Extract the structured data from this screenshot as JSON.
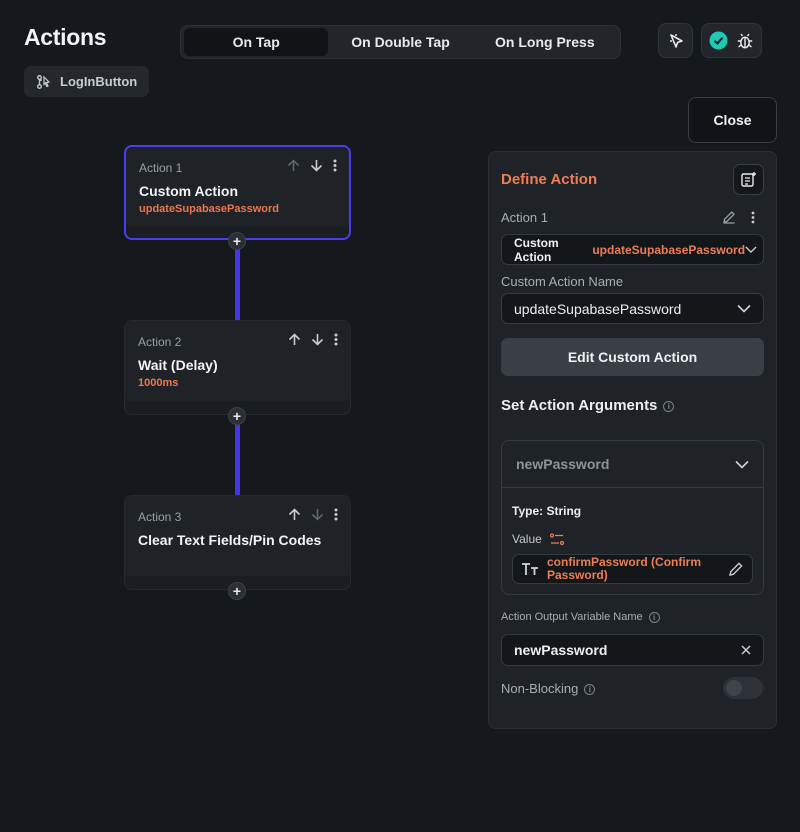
{
  "header": {
    "title": "Actions",
    "widget_name": "LogInButton",
    "close_label": "Close"
  },
  "trigger_tabs": [
    {
      "label": "On Tap",
      "active": true
    },
    {
      "label": "On Double Tap",
      "active": false
    },
    {
      "label": "On Long Press",
      "active": false
    }
  ],
  "flow": {
    "actions": [
      {
        "label": "Action 1",
        "title": "Custom Action",
        "subtitle": "updateSupabasePassword",
        "selected": true
      },
      {
        "label": "Action 2",
        "title": "Wait (Delay)",
        "subtitle": "1000ms",
        "selected": false
      },
      {
        "label": "Action 3",
        "title": "Clear Text Fields/Pin Codes",
        "subtitle": "",
        "selected": false
      }
    ]
  },
  "panel": {
    "title": "Define Action",
    "action_label": "Action 1",
    "action_type": "Custom Action",
    "action_type_value": "updateSupabasePassword",
    "custom_action_name_label": "Custom Action Name",
    "custom_action_name_value": "updateSupabasePassword",
    "edit_button_label": "Edit Custom Action",
    "arguments_heading": "Set Action Arguments",
    "argument": {
      "name": "newPassword",
      "type_label": "Type: String",
      "value_label": "Value",
      "value": "confirmPassword (Confirm Password)"
    },
    "output_var_label": "Action Output Variable Name",
    "output_var_value": "newPassword",
    "non_blocking_label": "Non-Blocking",
    "non_blocking_enabled": false
  },
  "colors": {
    "accent_orange": "#ee7d56",
    "connector_blue": "#4336e8",
    "check_teal": "#1fc9b3"
  }
}
